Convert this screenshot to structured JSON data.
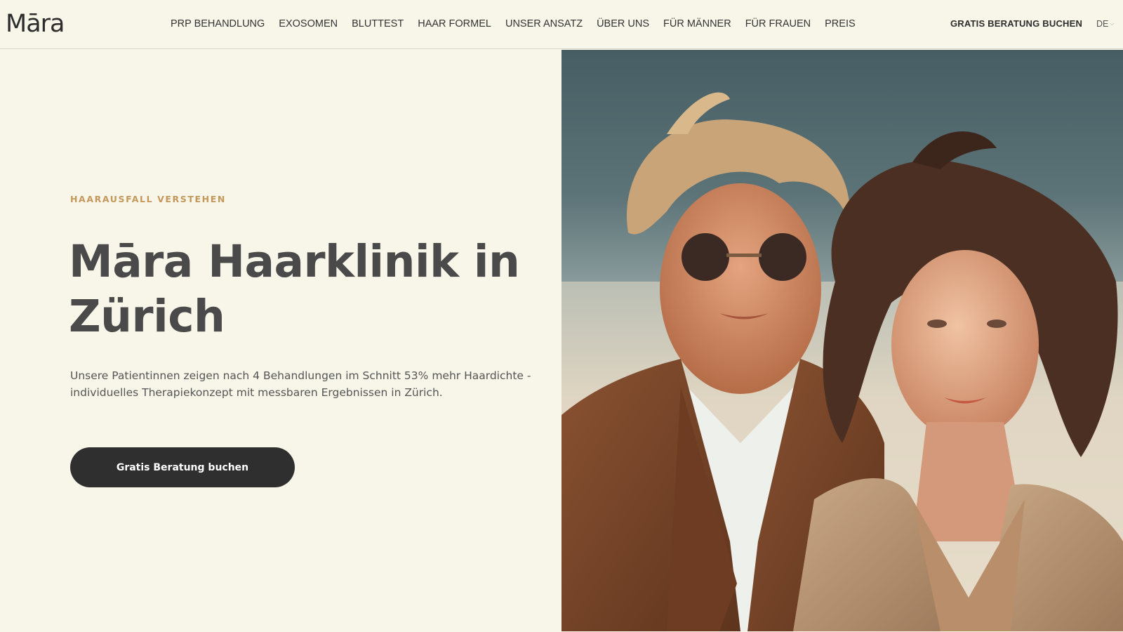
{
  "brand": {
    "logo": "Māra"
  },
  "nav": {
    "items": [
      {
        "label": "PRP BEHANDLUNG"
      },
      {
        "label": "EXOSOMEN"
      },
      {
        "label": "BLUTTEST"
      },
      {
        "label": "HAAR FORMEL"
      },
      {
        "label": "UNSER ANSATZ"
      },
      {
        "label": "ÜBER UNS"
      },
      {
        "label": "FÜR MÄNNER"
      },
      {
        "label": "FÜR FRAUEN"
      },
      {
        "label": "PREIS"
      }
    ],
    "cta_label": "GRATIS BERATUNG BUCHEN",
    "language": "DE"
  },
  "hero": {
    "eyebrow": "HAARAUSFALL VERSTEHEN",
    "title_line1": "Māra Haarklinik in",
    "title_line2": "Zürich",
    "subtitle": "Unsere Patientinnen zeigen nach 4 Behandlungen im Schnitt 53% mehr Haardichte - individuelles Therapiekonzept mit messbaren Ergebnissen in Zürich.",
    "cta_label": "Gratis Beratung buchen"
  },
  "colors": {
    "background": "#f8f5e9",
    "accent": "#c4985a",
    "text": "#4a4a4a",
    "button": "#2f2f2f"
  }
}
